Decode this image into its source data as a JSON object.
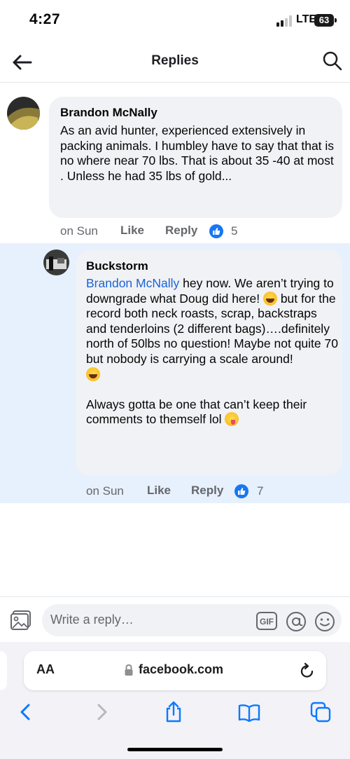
{
  "status_bar": {
    "time": "4:27",
    "network": "LTE",
    "battery": "63"
  },
  "header": {
    "title": "Replies",
    "back_icon": "arrow-left-icon",
    "search_icon": "search-icon"
  },
  "comment": {
    "author": "Brandon McNally",
    "text": "As an avid hunter, experienced extensively in packing animals. I humbley have to say that that is no where near 70 lbs. That is about 35 -40 at most\n. Unless he had 35 lbs of gold...",
    "time": "on Sun",
    "like_label": "Like",
    "reply_label": "Reply",
    "reaction_count": "5"
  },
  "reply": {
    "author": "Buckstorm",
    "mention": "Brandon McNally",
    "text_1": " hey now. We aren’t trying to downgrade what Doug did here! ",
    "text_2": " but for the record both neck roasts, scrap, backstraps and tenderloins (2 different bags)….definitely north of 50lbs no question! Maybe not quite 70 but nobody is carrying a scale around! ",
    "text_3": "Always gotta be one that can’t keep their comments to themself lol ",
    "time": "on Sun",
    "like_label": "Like",
    "reply_label": "Reply",
    "reaction_count": "7"
  },
  "composer": {
    "placeholder": "Write a reply…",
    "gif_label": "GIF",
    "photo_icon": "photo-icon",
    "at_icon": "at-sign-icon",
    "emoji_icon": "smiley-icon"
  },
  "browser": {
    "aa_label": "AA",
    "url": "facebook.com",
    "accent_color": "#0a7aff"
  },
  "colors": {
    "mention": "#1b64d6",
    "highlight": "#e7f0fd",
    "bubble": "#f0f2f5",
    "like_blue": "#1877f2"
  }
}
